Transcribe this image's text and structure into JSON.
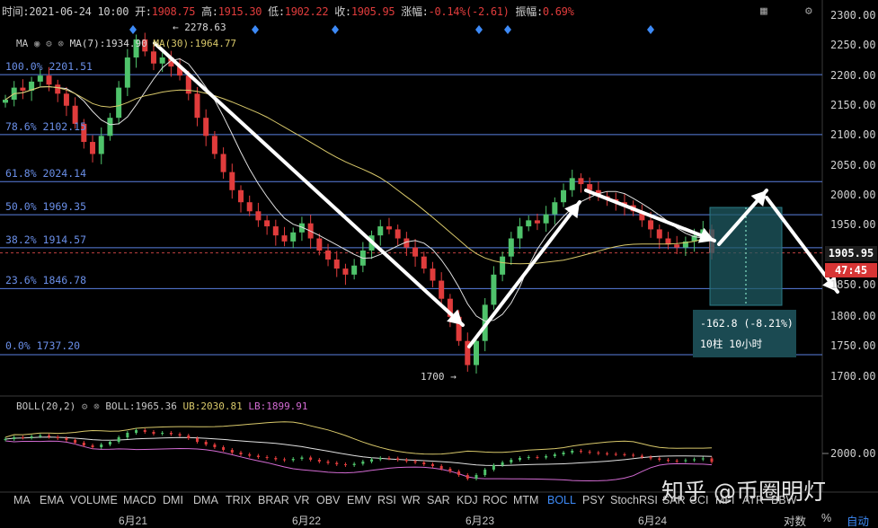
{
  "header": {
    "time_label": "时间:",
    "time_value": "2021-06-24 10:00",
    "open_label": "开:",
    "open_value": "1908.75",
    "high_label": "高:",
    "high_value": "1915.30",
    "low_label": "低:",
    "low_value": "1902.22",
    "close_label": "收:",
    "close_value": "1905.95",
    "change_label": "涨幅:",
    "change_value": "-0.14%(-2.61)",
    "amp_label": "振幅:",
    "amp_value": "0.69%"
  },
  "ma_legend": {
    "name": "MA",
    "ma7": "MA(7):1934.90",
    "ma30": "MA(30):1964.77"
  },
  "boll_legend": {
    "name": "BOLL(20,2)",
    "boll": "BOLL:1965.36",
    "ub": "UB:2030.81",
    "lb": "LB:1899.91"
  },
  "fib_labels": [
    "100.0% 2201.51",
    "78.6% 2102.15",
    "61.8% 2024.14",
    "50.0% 1969.35",
    "38.2% 1914.57",
    "23.6% 1846.78",
    "0.0% 1737.20"
  ],
  "y_ticks": [
    "2300.00",
    "2250.00",
    "2200.00",
    "2150.00",
    "2100.00",
    "2050.00",
    "2000.00",
    "1950.00",
    "1900.00",
    "1850.00",
    "1800.00",
    "1750.00",
    "1700.00"
  ],
  "boll_tick": "2000.00",
  "price_tag": "1905.95",
  "time_tag": "47:45",
  "measure": {
    "change": "-162.8 (-8.21%)",
    "bars": "10柱  10小时"
  },
  "annotations": {
    "high": "← 2278.63",
    "low": "1700 →"
  },
  "x_ticks": [
    "6月21",
    "6月22",
    "6月23",
    "6月24"
  ],
  "tabs": [
    "MA",
    "EMA",
    "VOLUME",
    "MACD",
    "DMI",
    "DMA",
    "TRIX",
    "BRAR",
    "VR",
    "OBV",
    "EMV",
    "RSI",
    "WR",
    "SAR",
    "KDJ",
    "ROC",
    "MTM",
    "BOLL",
    "PSY",
    "StochRSI",
    "SAR",
    "CCI",
    "MFI",
    "ATR",
    "BBW"
  ],
  "active_tab": "BOLL",
  "corner": {
    "log": "对数",
    "pct": "%",
    "auto": "自动"
  },
  "watermark": "知乎 @币圈明灯",
  "icons": [
    "eye-icon",
    "gear-icon",
    "close-icon",
    "calendar-icon",
    "settings-icon"
  ],
  "colors": {
    "up": "#4fc36b",
    "down": "#e03c3c",
    "fib": "#5a7fe0",
    "ma7": "#e0e0e0",
    "ma30": "#d8c86a",
    "lb": "#d36bd3",
    "accent": "#3d8af7"
  },
  "chart_data": {
    "type": "candlestick",
    "title": "",
    "y_range": [
      1680,
      2305
    ],
    "fib_levels": [
      2201.51,
      2102.15,
      2024.14,
      1969.35,
      1914.57,
      1846.78,
      1737.2
    ],
    "swing_points": {
      "high": 2278.63,
      "low": 1700,
      "last_close": 1905.95
    },
    "candles_close_approx": [
      2160,
      2180,
      2175,
      2190,
      2200,
      2185,
      2170,
      2150,
      2120,
      2090,
      2070,
      2100,
      2130,
      2180,
      2230,
      2260,
      2240,
      2220,
      2230,
      2215,
      2200,
      2170,
      2130,
      2100,
      2070,
      2040,
      2010,
      1990,
      1975,
      1960,
      1950,
      1935,
      1925,
      1940,
      1955,
      1930,
      1910,
      1895,
      1880,
      1870,
      1885,
      1910,
      1935,
      1950,
      1945,
      1930,
      1915,
      1900,
      1880,
      1860,
      1830,
      1800,
      1760,
      1720,
      1760,
      1820,
      1870,
      1900,
      1930,
      1950,
      1960,
      1955,
      1970,
      1990,
      2010,
      2030,
      2020,
      2010,
      2000,
      1995,
      1990,
      1985,
      1975,
      1960,
      1945,
      1930,
      1920,
      1915,
      1925,
      1935,
      1945,
      1906
    ]
  }
}
